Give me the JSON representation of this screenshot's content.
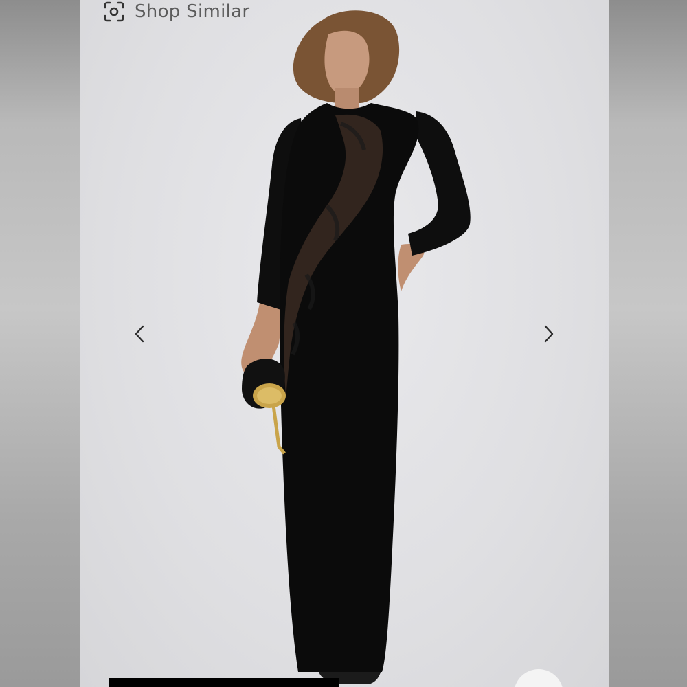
{
  "header": {
    "shop_similar_label": "Shop Similar",
    "shop_similar_icon": "visual-search-icon"
  },
  "gallery": {
    "prev_icon": "chevron-left-icon",
    "next_icon": "chevron-right-icon"
  },
  "colors": {
    "background": "#dfdfe2",
    "dress": "#0b0b0b",
    "accent_gold": "#c9a44a",
    "label_gray": "#5b5b5b"
  }
}
